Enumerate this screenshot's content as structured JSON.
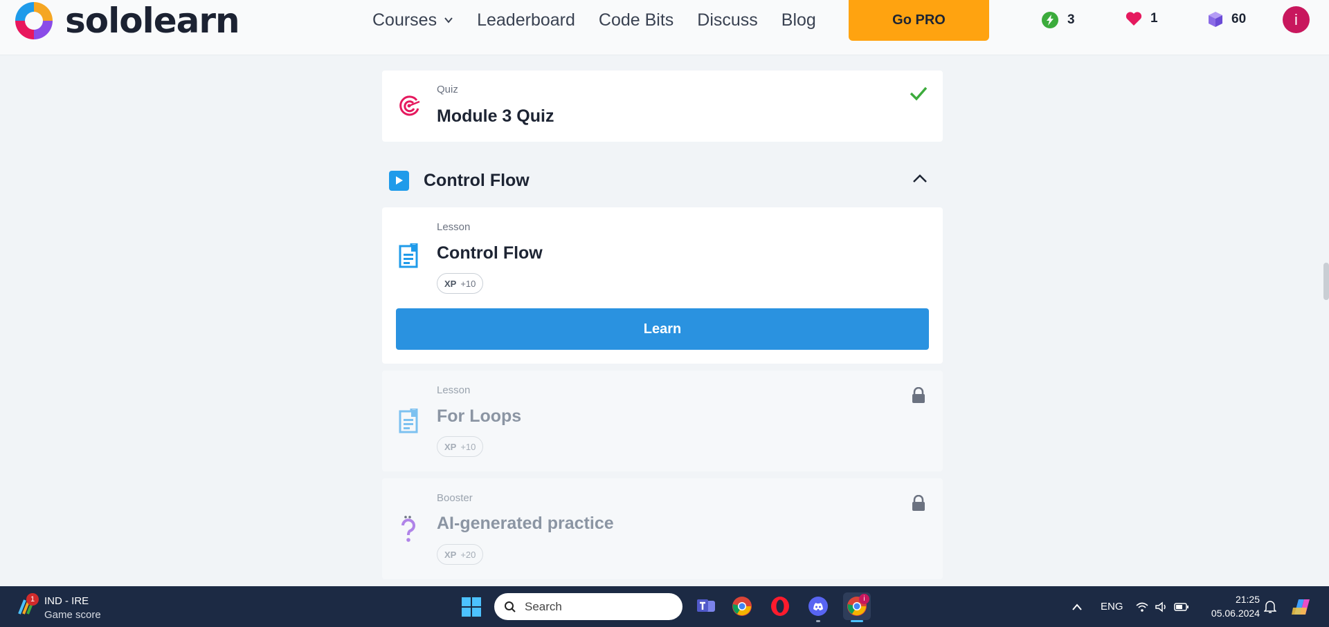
{
  "brand": {
    "name": "sololearn"
  },
  "nav": {
    "items": [
      {
        "label": "Courses",
        "has_dropdown": true
      },
      {
        "label": "Leaderboard"
      },
      {
        "label": "Code Bits"
      },
      {
        "label": "Discuss"
      },
      {
        "label": "Blog"
      }
    ],
    "go_pro_label": "Go PRO"
  },
  "stats": {
    "streak": "3",
    "hearts": "1",
    "bits": "60"
  },
  "user": {
    "avatar_initial": "i"
  },
  "quiz_card": {
    "kind": "Quiz",
    "title": "Module 3 Quiz",
    "completed": true
  },
  "section": {
    "title": "Control Flow",
    "expanded": true
  },
  "lessons": [
    {
      "kind": "Lesson",
      "title": "Control Flow",
      "xp_label": "XP",
      "xp_value": "+10",
      "action_label": "Learn",
      "locked": false
    },
    {
      "kind": "Lesson",
      "title": "For Loops",
      "xp_label": "XP",
      "xp_value": "+10",
      "locked": true
    },
    {
      "kind": "Booster",
      "title": "AI-generated practice",
      "xp_label": "XP",
      "xp_value": "+20",
      "locked": true
    }
  ],
  "taskbar": {
    "weather": {
      "badge": "1",
      "line1": "IND - IRE",
      "line2": "Game score"
    },
    "search_placeholder": "Search",
    "language": "ENG",
    "time": "21:25",
    "date": "05.06.2024",
    "chrome_badge": "i"
  },
  "colors": {
    "accent_blue": "#2a92e0",
    "go_pro": "#ffa310",
    "quiz_icon": "#e5195e",
    "check": "#3cab3c",
    "avatar": "#c8175d"
  }
}
